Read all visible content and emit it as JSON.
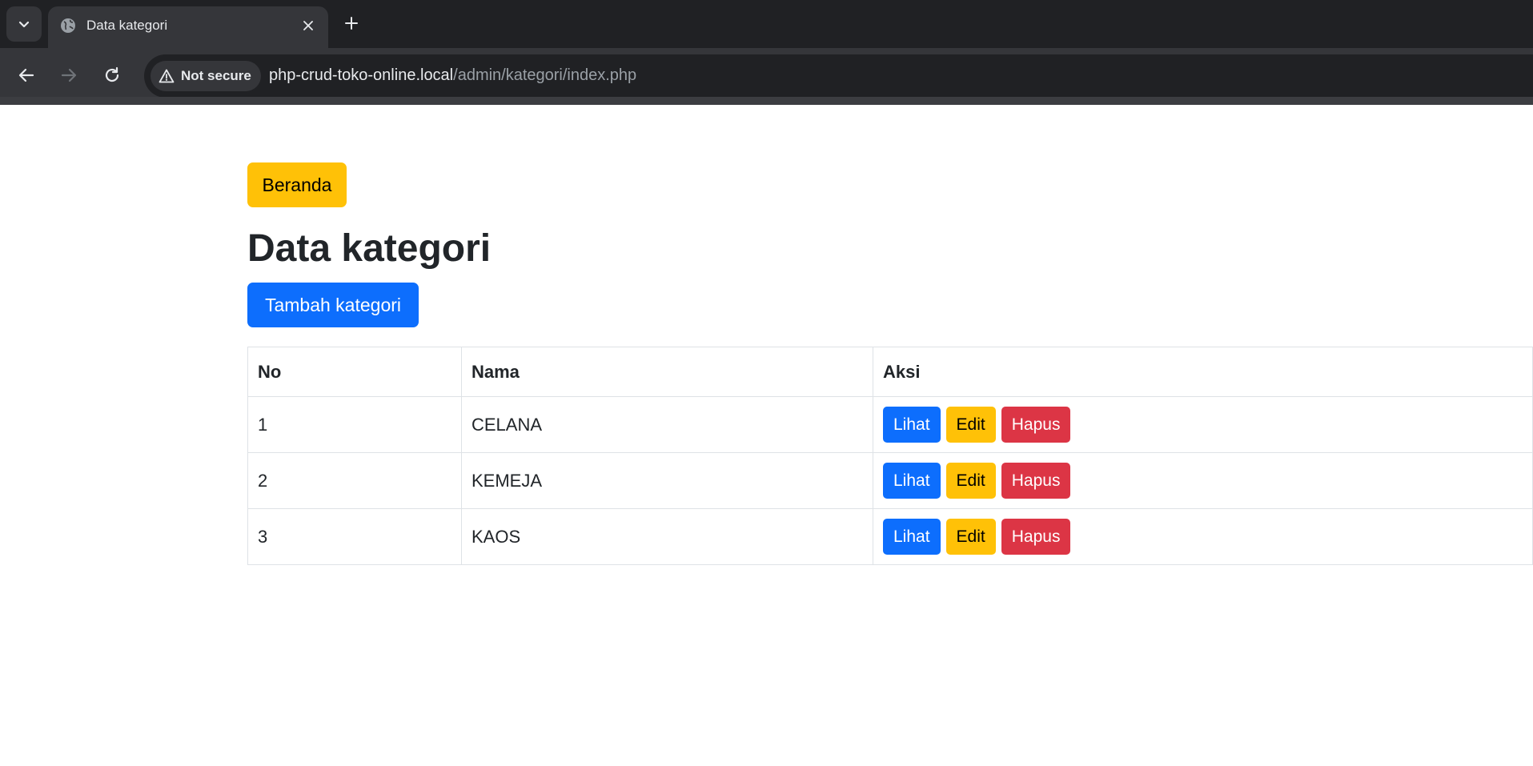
{
  "browser": {
    "tab": {
      "title": "Data kategori"
    },
    "security_label": "Not secure",
    "url_host": "php-crud-toko-online.local",
    "url_path": "/admin/kategori/index.php"
  },
  "page": {
    "home_button": "Beranda",
    "title": "Data kategori",
    "add_button": "Tambah kategori",
    "table": {
      "headers": {
        "no": "No",
        "nama": "Nama",
        "aksi": "Aksi"
      },
      "rows": [
        {
          "no": "1",
          "nama": "CELANA"
        },
        {
          "no": "2",
          "nama": "KEMEJA"
        },
        {
          "no": "3",
          "nama": "KAOS"
        }
      ],
      "actions": {
        "view": "Lihat",
        "edit": "Edit",
        "delete": "Hapus"
      }
    }
  },
  "colors": {
    "primary": "#0d6efd",
    "warning": "#ffc107",
    "danger": "#dc3545",
    "chrome_dark": "#202124",
    "chrome_mid": "#35363a"
  },
  "icons": [
    "tab-list-chevron-icon",
    "globe-icon",
    "close-icon",
    "plus-icon",
    "back-arrow-icon",
    "forward-arrow-icon",
    "reload-icon",
    "warning-triangle-icon"
  ]
}
